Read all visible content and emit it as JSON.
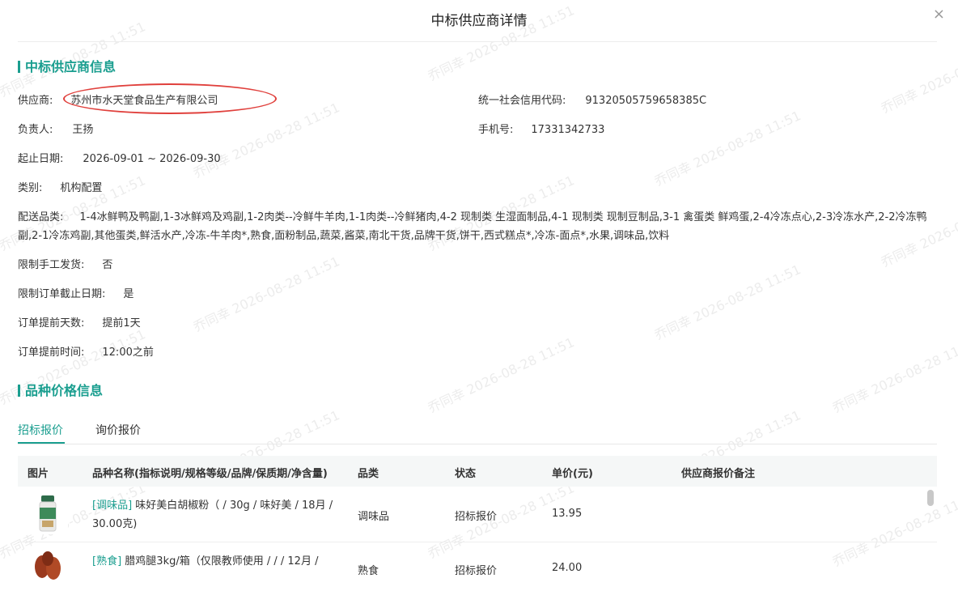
{
  "dialog": {
    "title": "中标供应商详情",
    "close": "×"
  },
  "supplier_section": {
    "title": "中标供应商信息",
    "supplier_label": "供应商:",
    "supplier_value": "苏州市水天堂食品生产有限公司",
    "credit_label": "统一社会信用代码:",
    "credit_value": "91320505759658385C",
    "manager_label": "负责人:",
    "manager_value": "王扬",
    "phone_label": "手机号:",
    "phone_value": "17331342733",
    "date_label": "起止日期:",
    "date_value": "2026-09-01 ~ 2026-09-30",
    "category_label": "类别:",
    "category_value": "机构配置",
    "delivery_label": "配送品类:",
    "delivery_value": "1-4冰鲜鸭及鸭副,1-3冰鲜鸡及鸡副,1-2肉类--冷鲜牛羊肉,1-1肉类--冷鲜猪肉,4-2 现制类 生湿面制品,4-1 现制类 现制豆制品,3-1 禽蛋类 鲜鸡蛋,2-4冷冻点心,2-3冷冻水产,2-2冷冻鸭副,2-1冷冻鸡副,其他蛋类,鲜活水产,冷冻-牛羊肉*,熟食,面粉制品,蔬菜,酱菜,南北干货,品牌干货,饼干,西式糕点*,冷冻-面点*,水果,调味品,饮料",
    "manual_label": "限制手工发货:",
    "manual_value": "否",
    "deadline_label": "限制订单截止日期:",
    "deadline_value": "是",
    "advance_days_label": "订单提前天数:",
    "advance_days_value": "提前1天",
    "advance_time_label": "订单提前时间:",
    "advance_time_value": "12:00之前"
  },
  "price_section": {
    "title": "品种价格信息",
    "tabs": [
      "招标报价",
      "询价报价"
    ],
    "active_tab": 0,
    "columns": [
      "图片",
      "品种名称(指标说明/规格等级/品牌/保质期/净含量)",
      "品类",
      "状态",
      "单价(元)",
      "供应商报价备注"
    ],
    "rows": [
      {
        "tag": "[调味品]",
        "name_line1": "味好美白胡椒粉（ / 30g / 味好美 / 18月 /",
        "name_line2": "30.00克)",
        "category": "调味品",
        "status": "招标报价",
        "price": "13.95",
        "remark": ""
      },
      {
        "tag": "[熟食]",
        "name_line1": "腊鸡腿3kg/箱（仅限教师使用 / / / 12月 /",
        "name_line2": "",
        "category": "熟食",
        "status": "招标报价",
        "price": "24.00",
        "remark": ""
      }
    ]
  },
  "watermark": "乔同幸 2026-08-28 11:51",
  "colors": {
    "accent": "#1a9e8f",
    "highlight_circle": "#e0403c"
  }
}
